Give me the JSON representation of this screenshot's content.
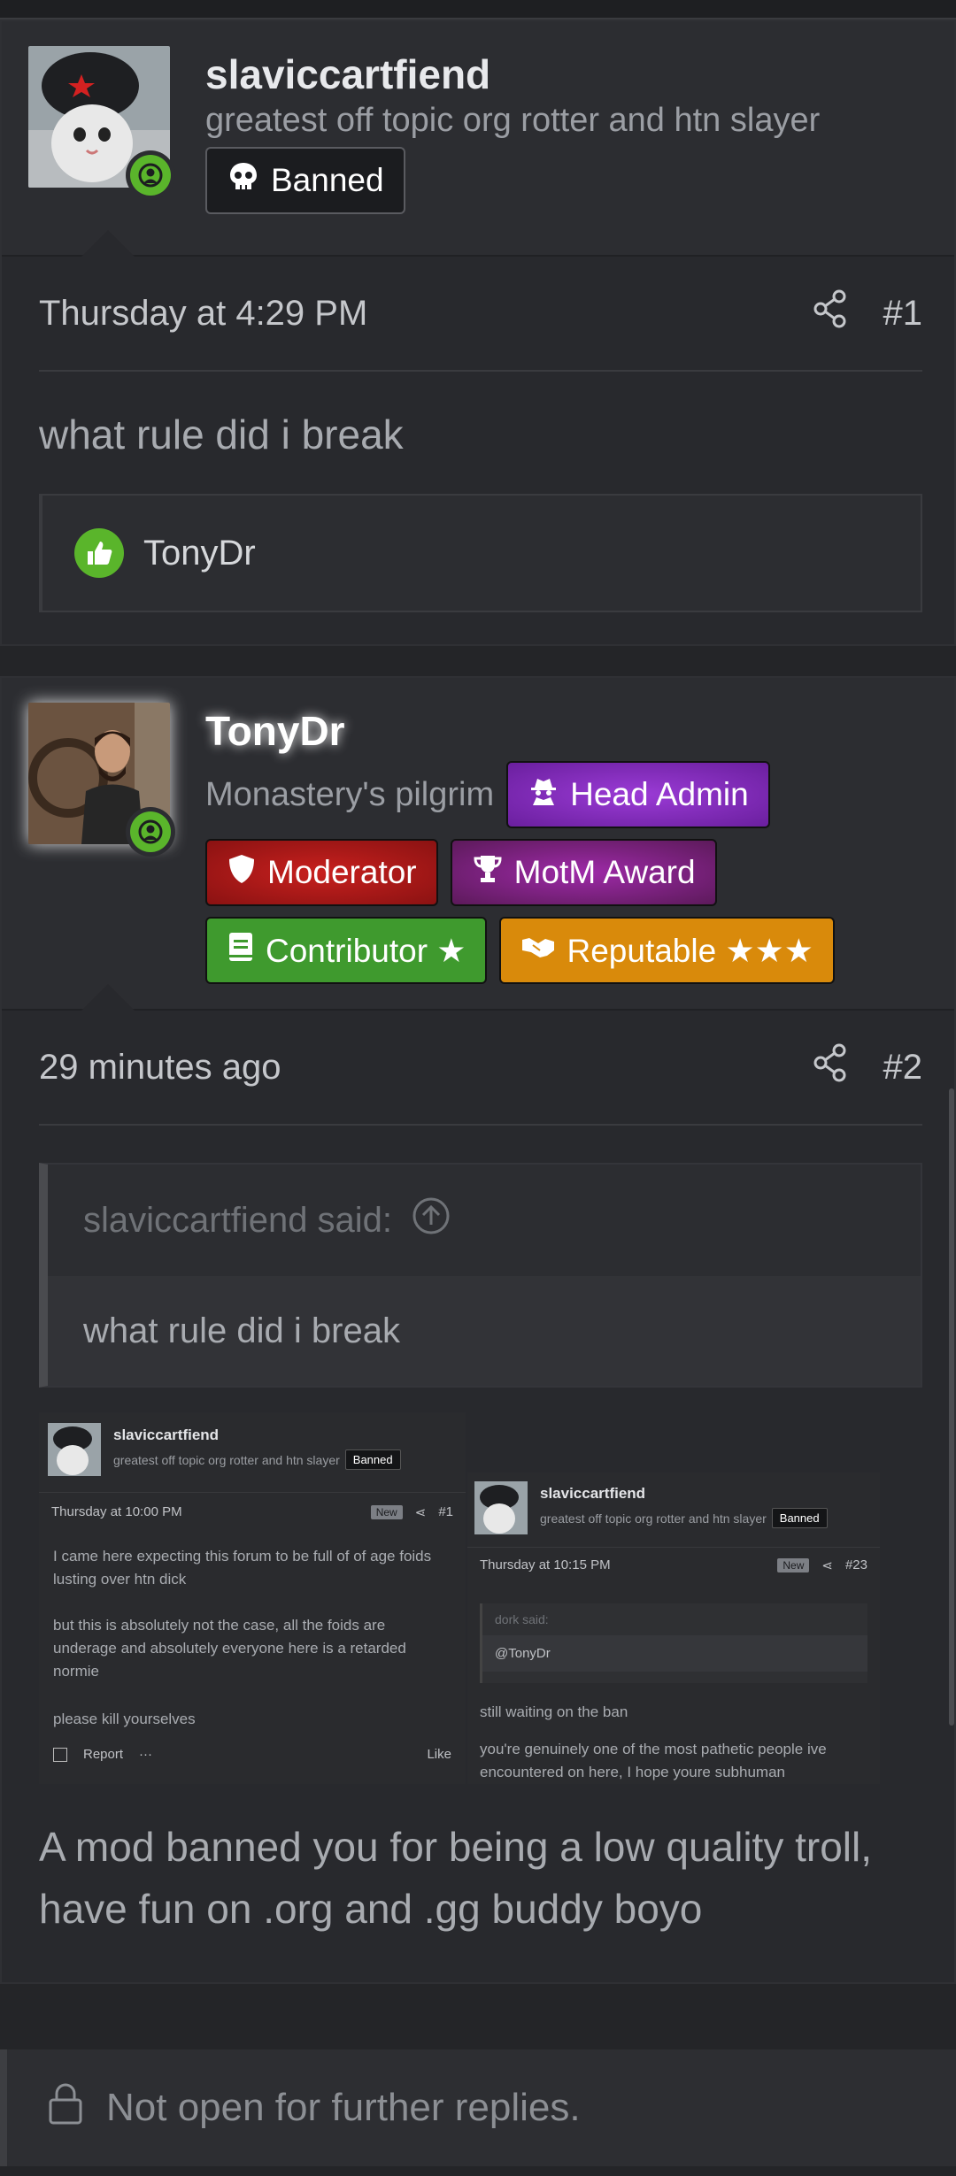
{
  "post1": {
    "username": "slaviccartfiend",
    "user_title": "greatest off topic org rotter and htn slayer",
    "banner": "Banned",
    "date": "Thursday at 4:29 PM",
    "number": "#1",
    "message": "what rule did i break",
    "reaction_user": "TonyDr"
  },
  "post2": {
    "username": "TonyDr",
    "user_title": "Monastery's pilgrim",
    "banners": {
      "head_admin": "Head Admin",
      "moderator": "Moderator",
      "motm": "MotM Award",
      "contributor": "Contributor ★",
      "reputable": "Reputable ★★★"
    },
    "date": "29 minutes ago",
    "number": "#2",
    "quote_author": "slaviccartfiend said:",
    "quote_text": "what rule did i break",
    "reply": "A mod banned you for being a low quality troll, have fun on .org and .gg buddy boyo"
  },
  "screenshot1": {
    "username": "slaviccartfiend",
    "user_title": "greatest off topic org rotter and htn slayer",
    "banner": "Banned",
    "date": "Thursday at 10:00 PM",
    "new": "New",
    "number": "#1",
    "p1": "I came here expecting this forum to be full of of age foids lusting over htn dick",
    "p2": "but this is absolutely not the case, all the foids are underage and absolutely everyone here is a retarded normie",
    "p3": "please kill yourselves",
    "report": "Report",
    "more": "···",
    "like": "Like"
  },
  "screenshot2": {
    "username": "slaviccartfiend",
    "user_title": "greatest off topic org rotter and htn slayer",
    "banner": "Banned",
    "date": "Thursday at 10:15 PM",
    "new": "New",
    "number": "#23",
    "quote_author": "dork said:",
    "quote_text": "@TonyDr",
    "p1": "still waiting on the ban",
    "p2": "you're genuinely one of the most pathetic people ive encountered on here, I hope youre subhuman"
  },
  "thread_status": "Not open for further replies.",
  "colors": {
    "online": "#5ab52b",
    "admin": "#7b2ab8",
    "moderator": "#a8181a",
    "contributor": "#3f9a2e",
    "reputable": "#d98a0b"
  }
}
